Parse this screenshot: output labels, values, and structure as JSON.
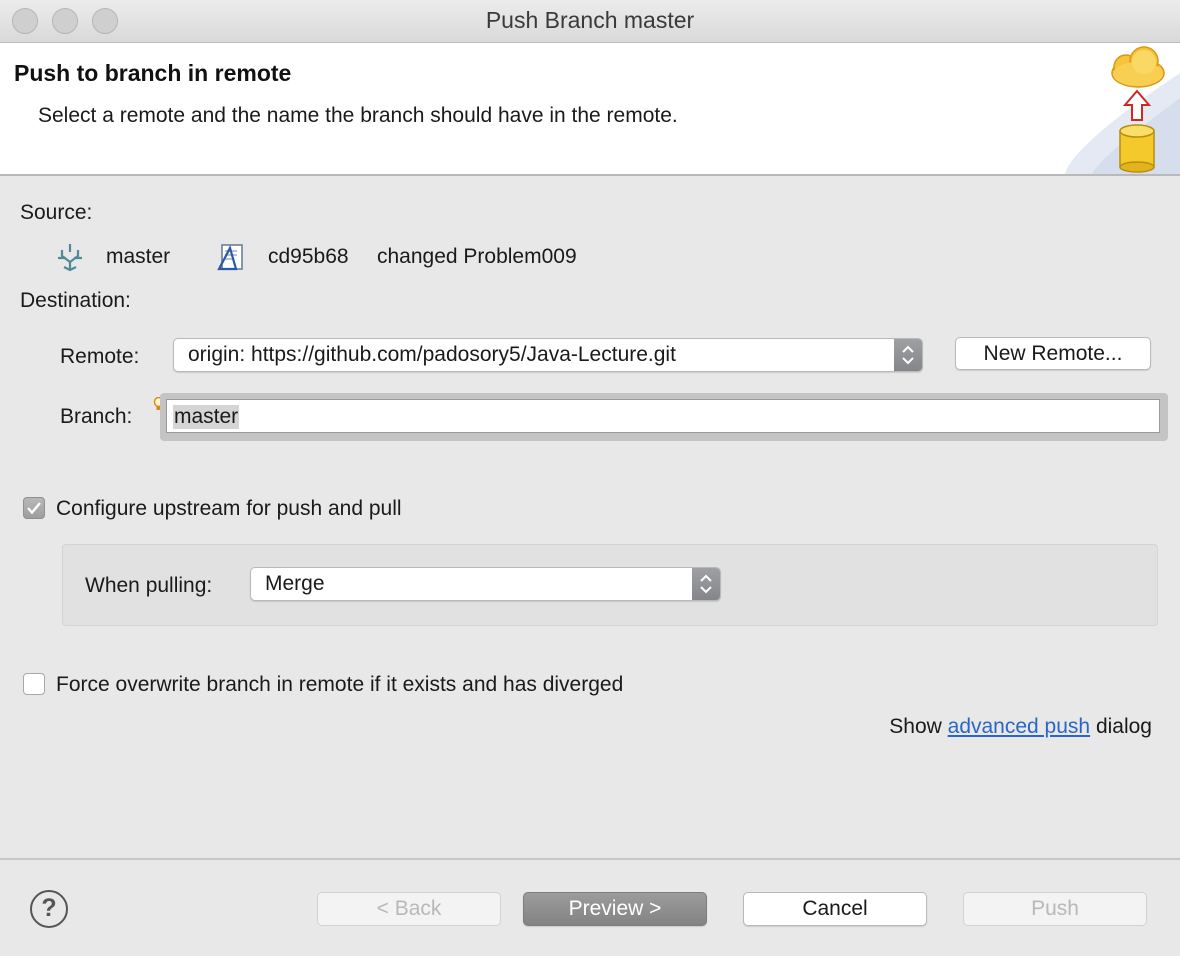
{
  "window": {
    "title": "Push Branch master"
  },
  "header": {
    "title": "Push to branch in remote",
    "description": "Select a remote and the name the branch should have in the remote."
  },
  "source": {
    "label": "Source:",
    "branch": "master",
    "commit_id": "cd95b68",
    "commit_message": "changed Problem009"
  },
  "destination": {
    "label": "Destination:",
    "remote_label": "Remote:",
    "remote_value": "origin: https://github.com/padosory5/Java-Lecture.git",
    "new_remote_button": "New Remote...",
    "branch_label": "Branch:",
    "branch_value": "master"
  },
  "options": {
    "configure_upstream_label": "Configure upstream for push and pull",
    "configure_upstream_checked": true,
    "when_pulling_label": "When pulling:",
    "when_pulling_value": "Merge",
    "force_overwrite_label": "Force overwrite branch in remote if it exists and has diverged",
    "force_overwrite_checked": false
  },
  "advanced": {
    "prefix": "Show",
    "link": "advanced push",
    "suffix": "dialog"
  },
  "footer": {
    "help_label": "?",
    "back_button": "< Back",
    "preview_button": "Preview >",
    "cancel_button": "Cancel",
    "push_button": "Push"
  },
  "colors": {
    "link": "#2a66c8",
    "accent_gray": "#8f8f8f"
  }
}
